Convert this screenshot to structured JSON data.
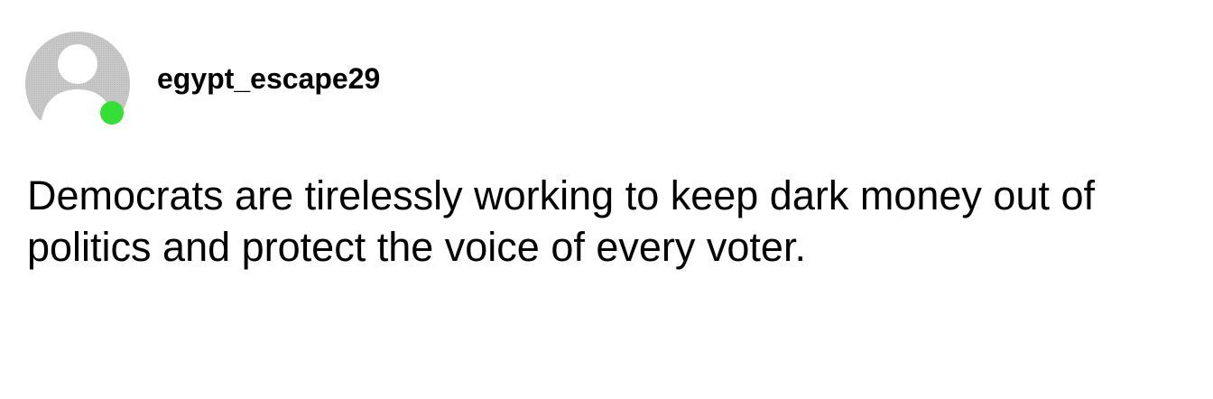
{
  "post": {
    "username": "egypt_escape29",
    "text": "Democrats are tirelessly working to keep dark money out of politics and protect the voice of every voter.",
    "avatar_icon": "default-user-avatar-icon",
    "status": "online"
  },
  "colors": {
    "avatar_gray": "#c6c6c6",
    "online_green": "#33e033",
    "background": "#ffffff",
    "text": "#000000"
  }
}
